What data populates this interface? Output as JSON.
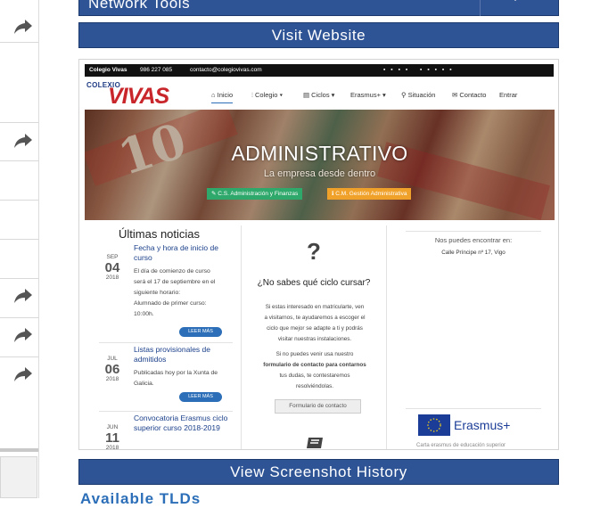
{
  "network_tools": {
    "label": "Network Tools"
  },
  "visit_website": {
    "label": "Visit Website"
  },
  "view_history": {
    "label": "View Screenshot History"
  },
  "bottom_partial": {
    "label": "Available TLDs"
  },
  "preview": {
    "topbar": {
      "site": "Colegio Vivas",
      "phone": "986 227 085",
      "email": "contacto@colegiovivas.com"
    },
    "logo": {
      "small": "COLEXIO",
      "big": "VIVAS"
    },
    "nav": [
      "Inicio",
      "Colegio ▾",
      "Ciclos ▾",
      "Erasmus+ ▾",
      "Situación",
      "Contacto",
      "Entrar"
    ],
    "hero": {
      "title": "ADMINISTRATIVO",
      "subtitle": "La empresa desde dentro",
      "btn1": "C.S. Administración y Finanzas",
      "btn2": "C.M. Gestión Administrativa"
    },
    "news_heading": "Últimas noticias",
    "news": [
      {
        "mon": "SEP",
        "day": "04",
        "yr": "2018",
        "title": "Fecha y hora de inicio de curso",
        "lines": [
          "El día de comienzo de curso",
          "será el 17 de septiembre en el",
          "siguiente horario:",
          "Alumnado de primer curso:",
          "10:00h."
        ],
        "more": "LEER MÁS"
      },
      {
        "mon": "JUL",
        "day": "06",
        "yr": "2018",
        "title": "Listas provisionales de admitidos",
        "lines": [
          "Publicadas hoy por la Xunta de",
          "Galicia."
        ],
        "more": "LEER MÁS"
      },
      {
        "mon": "JUN",
        "day": "11",
        "yr": "2018",
        "title": "Convocatoria Erasmus ciclo superior curso 2018-2019",
        "lines": [],
        "more": ""
      }
    ],
    "middle": {
      "q": "?",
      "title": "¿No sabes qué ciclo cursar?",
      "body1": [
        "Si estas interesado en matricularte, ven",
        "a visitarnos, te ayudaremos a escoger el",
        "ciclo que mejor se adapte a ti y podrás",
        "visitar nuestras instalaciones."
      ],
      "body2": [
        "Si no puedes venir usa nuestro",
        "formulario de contacto para contarnos",
        "tus dudas, te contestaremos",
        "resolviéndolas."
      ],
      "button": "Formulario de contacto"
    },
    "right": {
      "find": "Nos puedes encontrar en:",
      "addr": "Calle Príncipe nº 17, Vigo",
      "erasmus": "Erasmus+",
      "foot": "Carta erasmus de educación superior"
    }
  },
  "colors": {
    "bar": "#2f5496",
    "link": "#2c6fb8"
  }
}
